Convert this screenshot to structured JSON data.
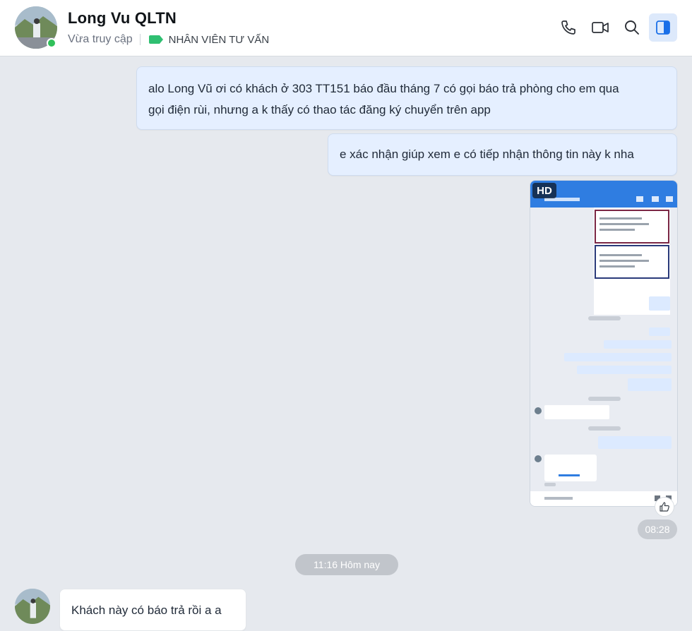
{
  "header": {
    "contact_name": "Long Vu QLTN",
    "status": "Vừa truy cập",
    "role_tag": "NHÂN VIÊN TƯ VẤN",
    "tag_color": "#2fbf71",
    "actions": [
      {
        "name": "phone-icon"
      },
      {
        "name": "video-call-icon"
      },
      {
        "name": "search-icon"
      },
      {
        "name": "sidebar-toggle-icon",
        "active": true
      }
    ]
  },
  "messages": [
    {
      "direction": "out",
      "text_line1": "alo Long Vũ ơi có khách ở 303 TT151 báo đầu tháng 7 có gọi báo trả phòng cho em qua",
      "text_line2": "gọi điện rùi, nhưng a k thấy có thao tác đăng ký chuyển trên app"
    },
    {
      "direction": "out",
      "text": "e xác nhận giúp xem e có tiếp nhận thông tin này k nha"
    },
    {
      "direction": "out",
      "type": "image",
      "badge": "HD",
      "time": "08:28"
    },
    {
      "direction": "in",
      "text": "Khách này có báo trả rồi a a"
    }
  ],
  "date_separator": "11:16 Hôm nay",
  "colors": {
    "accent": "#1a6fe8",
    "out_bubble": "#e5efff",
    "background": "#e6e9ee"
  }
}
